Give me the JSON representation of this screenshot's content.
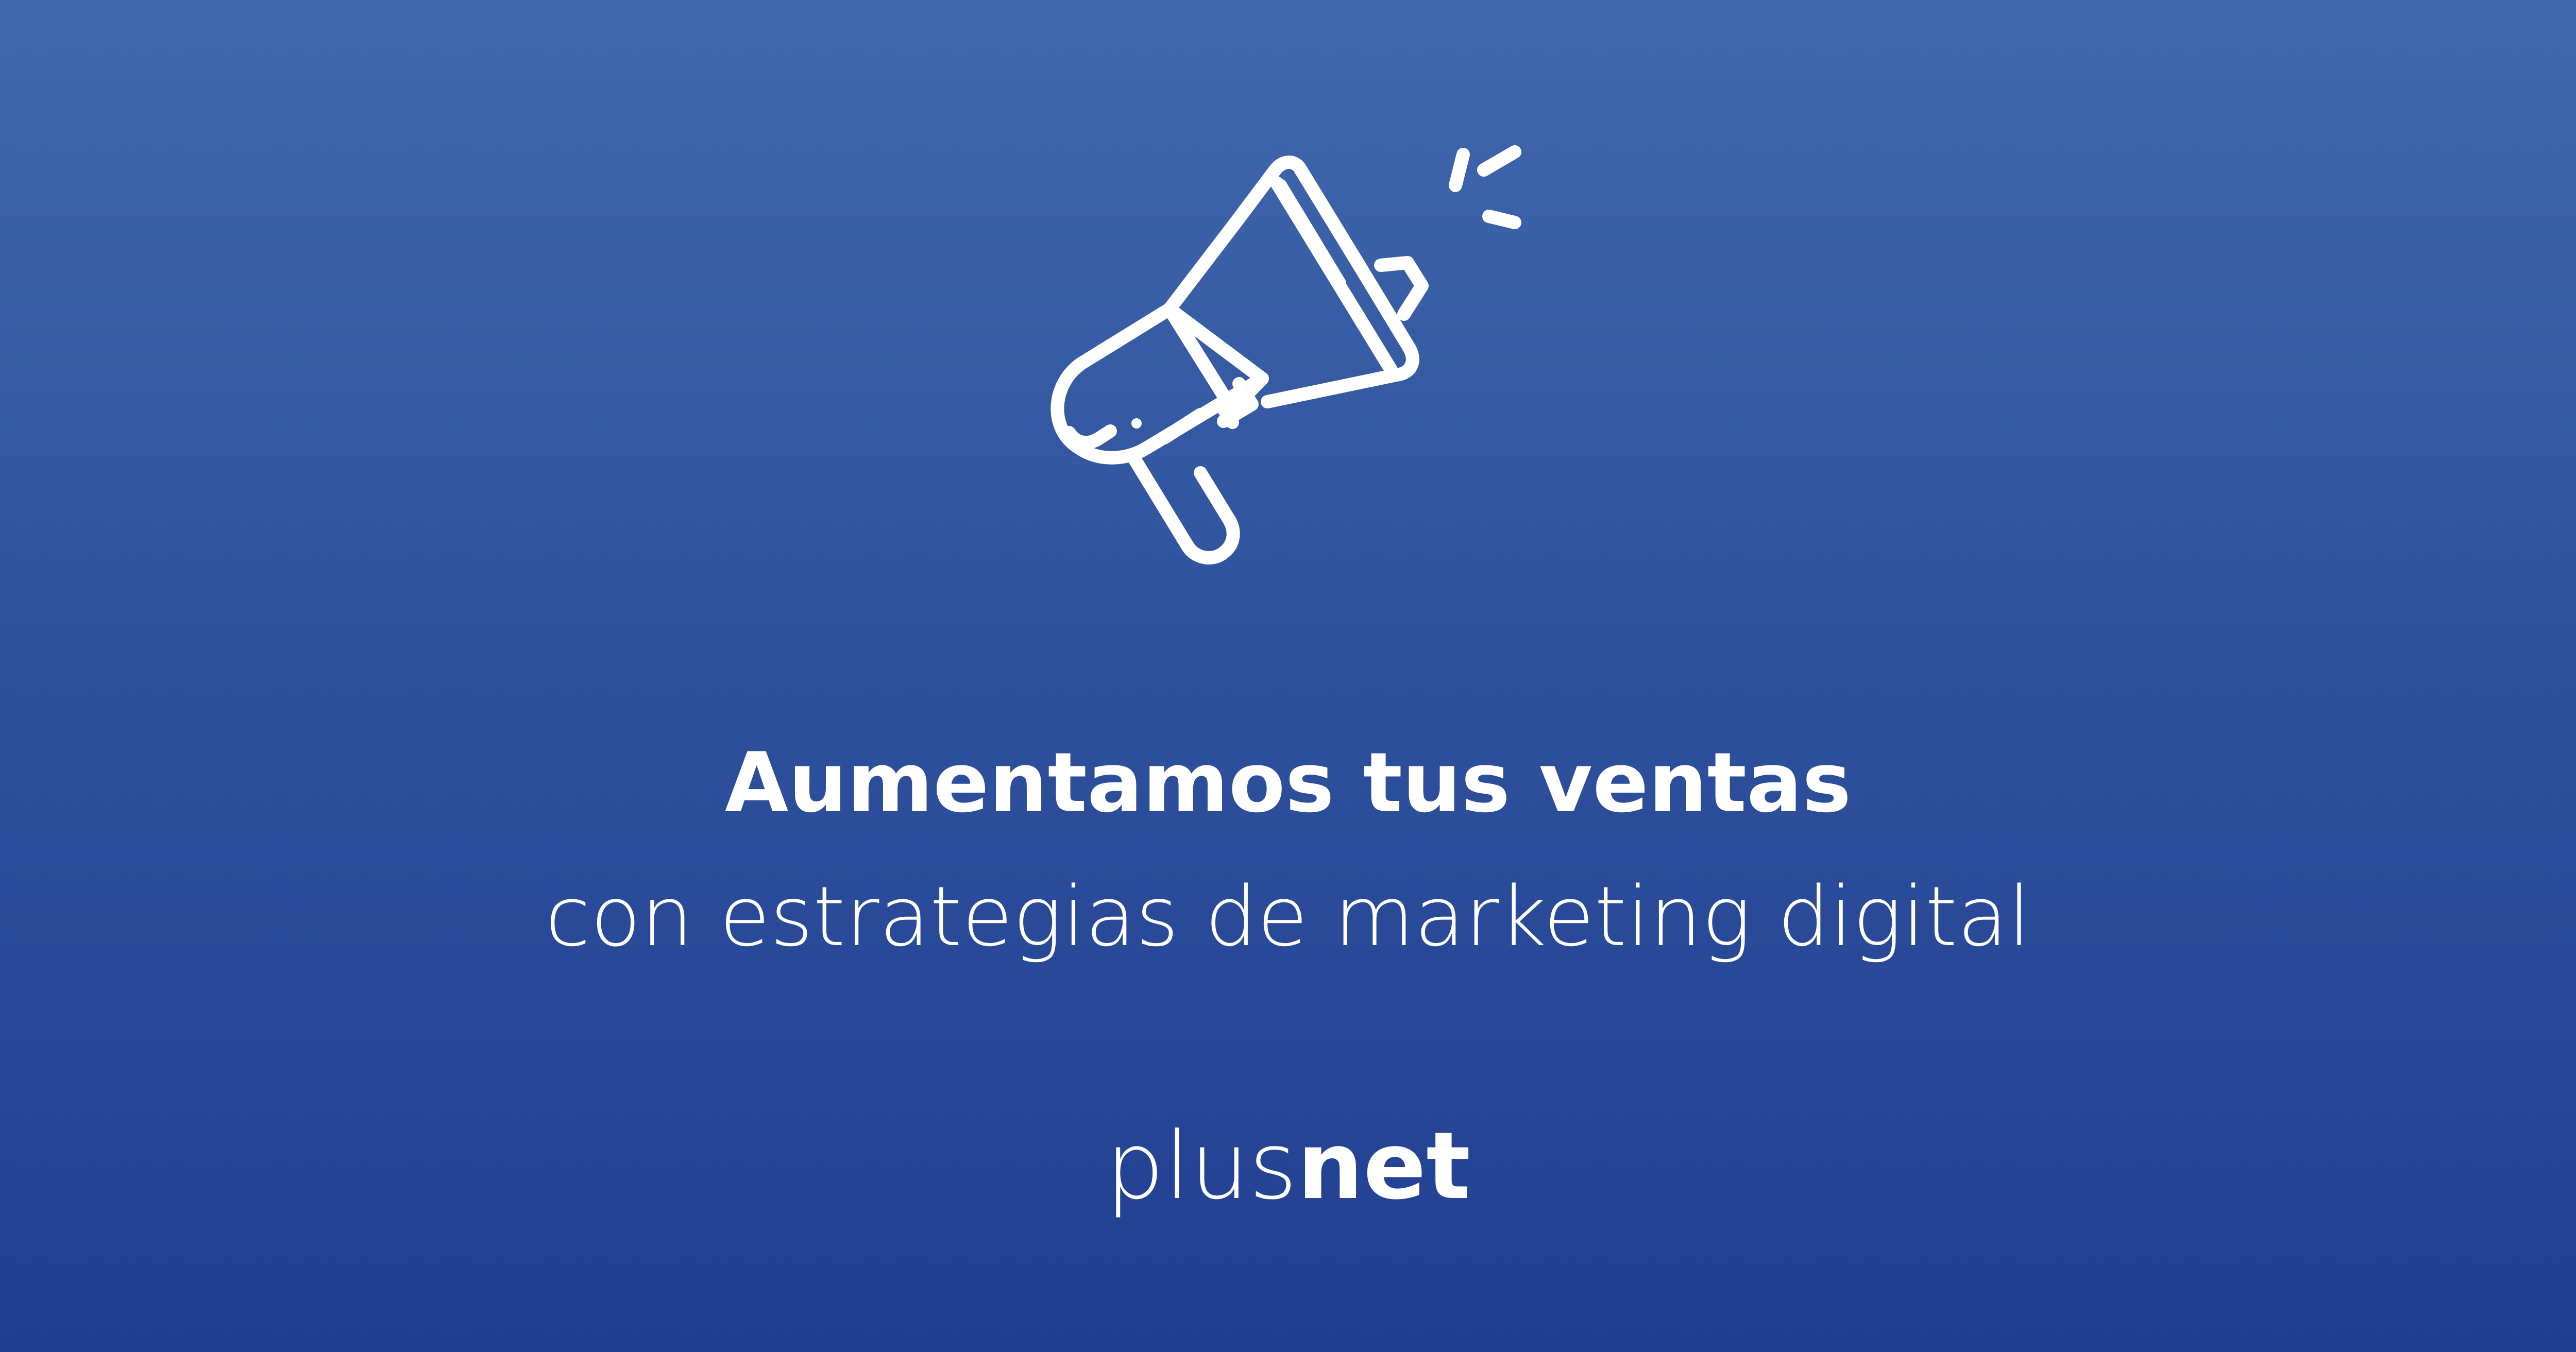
{
  "theme": {
    "background_top": "#4168AE",
    "background_bottom": "#223E91",
    "foreground": "#FFFFFF"
  },
  "icon": {
    "name": "megaphone-icon"
  },
  "headline": "Aumentamos tus ventas",
  "subheadline": "con estrategias de marketing digital",
  "brand": {
    "light": "plus",
    "bold": "net"
  }
}
